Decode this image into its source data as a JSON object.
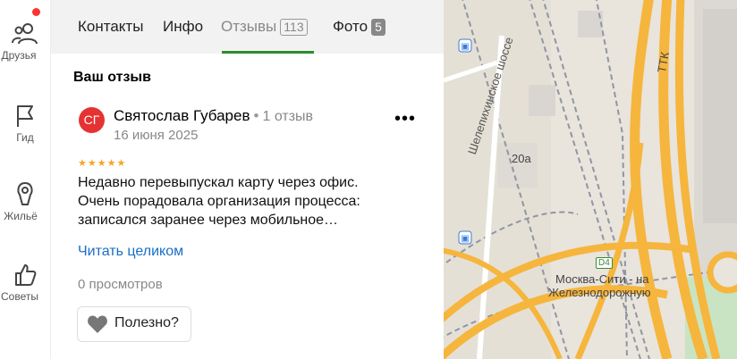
{
  "rail": {
    "items": [
      {
        "label": "Друзья",
        "icon": "friends-icon"
      },
      {
        "label": "Гид",
        "icon": "flag-icon"
      },
      {
        "label": "Жильё",
        "icon": "housing-icon"
      },
      {
        "label": "Советы",
        "icon": "thumbs-up-icon"
      }
    ]
  },
  "tabs": {
    "contacts": "Контакты",
    "info": "Инфо",
    "reviews": "Отзывы",
    "reviews_count": "113",
    "photos": "Фото",
    "photos_count": "5"
  },
  "review": {
    "heading": "Ваш отзыв",
    "avatar_initials": "СГ",
    "author": "Святослав Губарев",
    "author_reviews": "1 отзыв",
    "date": "16 июня 2025",
    "rating": 5,
    "stars": "★★★★★",
    "text": "Недавно перевыпускал карту через офис. Очень порадовала организация процесса: записался заранее через мобильное…",
    "read_more": "Читать целиком",
    "views": "0 просмотров",
    "useful_label": "Полезно?"
  },
  "map": {
    "street": "Шелепихинское шоссе",
    "building": "20а",
    "ring": "ТТК",
    "station_badge": "D4",
    "station_line1": "Москва-Сити - на",
    "station_line2": "Железнодорожную"
  },
  "colors": {
    "accent_tab": "#2e8b2e",
    "link": "#1a6ec7",
    "avatar": "#e63232",
    "stars": "#f5a623",
    "road": "#f6b53c"
  }
}
